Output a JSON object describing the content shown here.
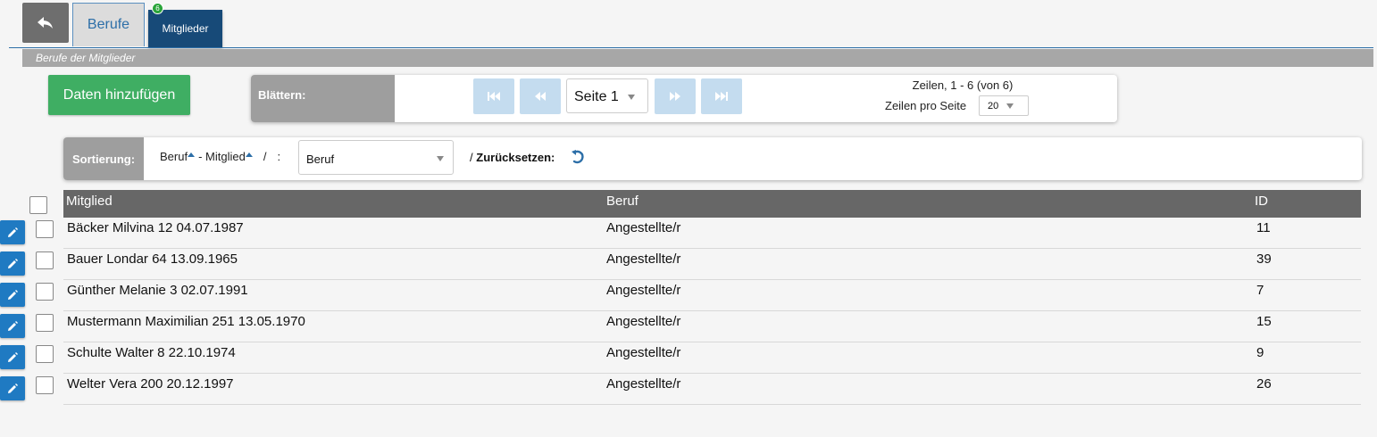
{
  "tabs": {
    "back_icon": "reply-icon",
    "berufe": "Berufe",
    "mitglieder": "Mitglieder",
    "mitglieder_badge": "6"
  },
  "section": {
    "title": "Berufe der Mitglieder"
  },
  "actions": {
    "add_label": "Daten hinzufügen"
  },
  "pager": {
    "label": "Blättern:",
    "page_select": "Seite 1",
    "rows_info": "Zeilen, 1 - 6 (von 6)",
    "rows_per_page_label": "Zeilen pro Seite",
    "rows_per_page": "20",
    "first_icon": "first-page-icon",
    "prev_icon": "prev-page-icon",
    "next_icon": "next-page-icon",
    "last_icon": "last-page-icon"
  },
  "sort": {
    "label": "Sortierung:",
    "field1": "Beruf",
    "sep1": "- Mitglied",
    "slash": "/",
    "colon": ":",
    "select_value": "Beruf",
    "reset_prefix": "/",
    "reset_label": "Zurücksetzen:"
  },
  "table": {
    "columns": [
      "Mitglied",
      "Beruf",
      "ID"
    ],
    "rows": [
      {
        "mitglied": "Bäcker Milvina 12 04.07.1987",
        "beruf": "Angestellte/r",
        "id": "11"
      },
      {
        "mitglied": "Bauer Londar 64 13.09.1965",
        "beruf": "Angestellte/r",
        "id": "39"
      },
      {
        "mitglied": "Günther Melanie 3 02.07.1991",
        "beruf": "Angestellte/r",
        "id": "7"
      },
      {
        "mitglied": "Mustermann Maximilian 251 13.05.1970",
        "beruf": "Angestellte/r",
        "id": "15"
      },
      {
        "mitglied": "Schulte Walter 8 22.10.1974",
        "beruf": "Angestellte/r",
        "id": "9"
      },
      {
        "mitglied": "Welter Vera 200 20.12.1997",
        "beruf": "Angestellte/r",
        "id": "26"
      }
    ]
  },
  "colors": {
    "primary": "#174a78",
    "link": "#2d6fa8",
    "success": "#3fae63",
    "edit": "#1f7ac2",
    "header": "#676767"
  }
}
